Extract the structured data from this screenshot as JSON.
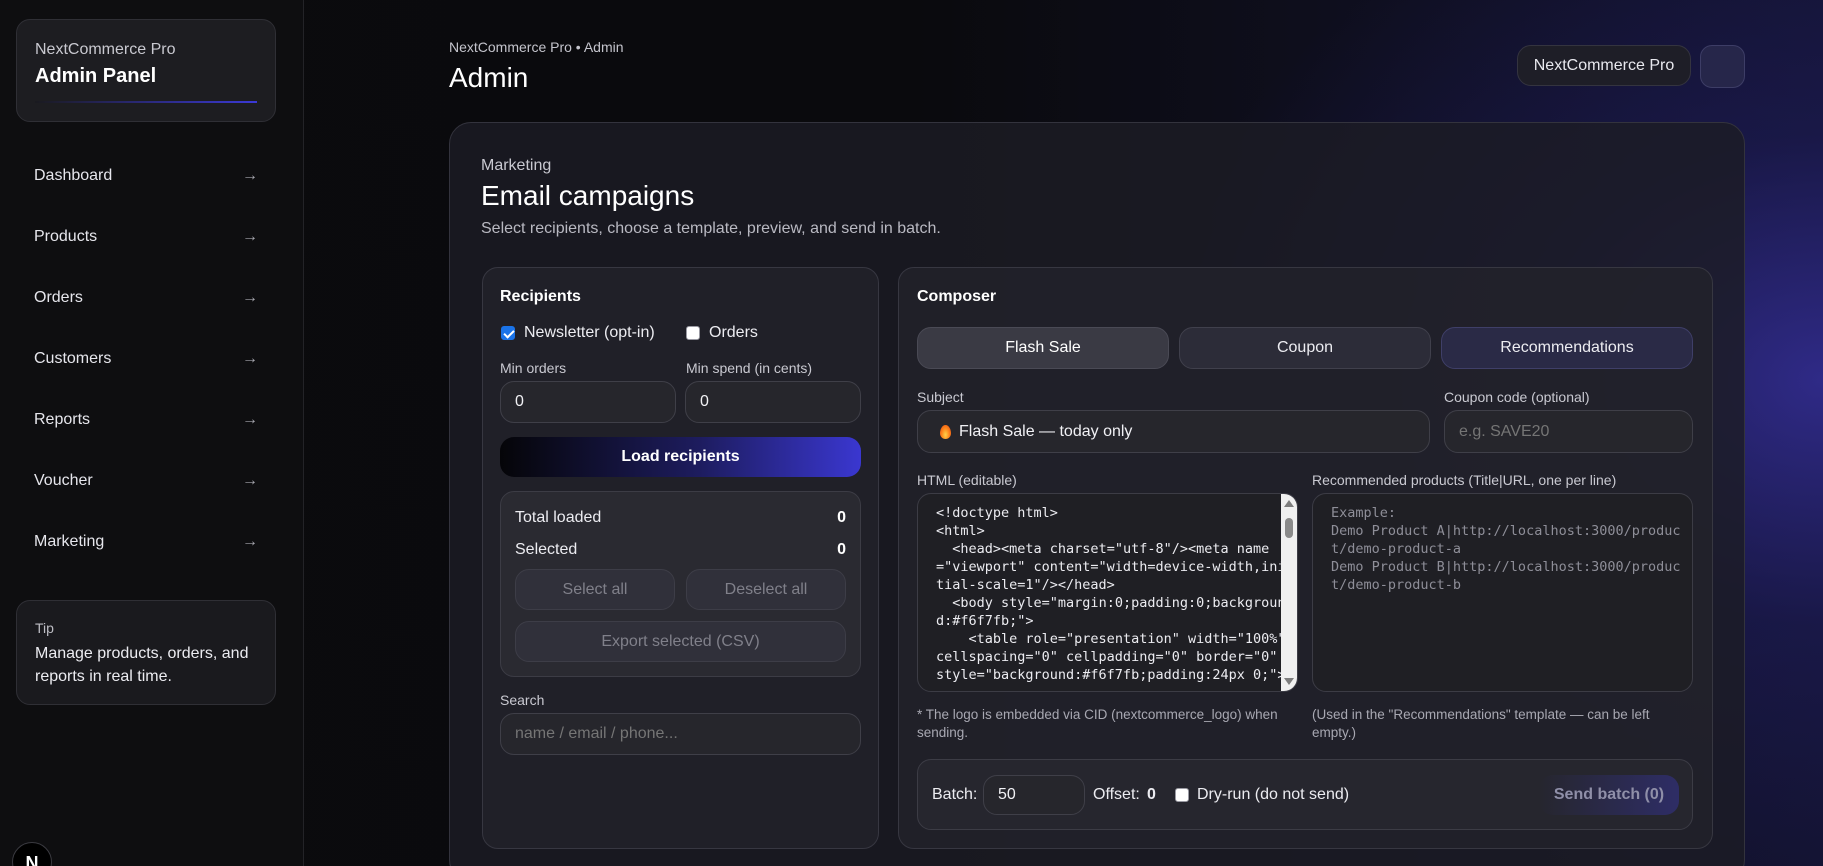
{
  "app": {
    "brand_sub": "NextCommerce Pro",
    "brand_title": "Admin Panel",
    "breadcrumb": "NextCommerce Pro • Admin",
    "page_title": "Admin",
    "top_pill": "NextCommerce Pro",
    "logo_letter": "N"
  },
  "sidebar": {
    "items": [
      {
        "label": "Dashboard",
        "arrow": "→"
      },
      {
        "label": "Products",
        "arrow": "→"
      },
      {
        "label": "Orders",
        "arrow": "→"
      },
      {
        "label": "Customers",
        "arrow": "→"
      },
      {
        "label": "Reports",
        "arrow": "→"
      },
      {
        "label": "Voucher",
        "arrow": "→"
      },
      {
        "label": "Marketing",
        "arrow": "→"
      }
    ],
    "tip_label": "Tip",
    "tip_text": "Manage products, orders, and reports in real time."
  },
  "section": {
    "label": "Marketing",
    "title": "Email campaigns",
    "description": "Select recipients, choose a template, preview, and send in batch."
  },
  "recipients": {
    "title": "Recipients",
    "newsletter_label": "Newsletter (opt-in)",
    "newsletter_checked": true,
    "orders_label": "Orders",
    "orders_checked": false,
    "min_orders_label": "Min orders",
    "min_orders_value": "0",
    "min_spend_label": "Min spend (in cents)",
    "min_spend_value": "0",
    "load_button": "Load recipients",
    "total_loaded_label": "Total loaded",
    "total_loaded_value": "0",
    "selected_label": "Selected",
    "selected_value": "0",
    "select_all": "Select all",
    "deselect_all": "Deselect all",
    "export_csv": "Export selected (CSV)",
    "search_label": "Search",
    "search_placeholder": "name / email / phone..."
  },
  "composer": {
    "title": "Composer",
    "tabs": [
      {
        "label": "Flash Sale"
      },
      {
        "label": "Coupon"
      },
      {
        "label": "Recommendations"
      }
    ],
    "subject_label": "Subject",
    "subject_value": "Flash Sale — today only",
    "coupon_label": "Coupon code (optional)",
    "coupon_placeholder": "e.g. SAVE20",
    "html_label": "HTML (editable)",
    "html_value": "<!doctype html>\n<html>\n  <head><meta charset=\"utf-8\"/><meta name=\"viewport\" content=\"width=device-width,initial-scale=1\"/></head>\n  <body style=\"margin:0;padding:0;background:#f6f7fb;\">\n    <table role=\"presentation\" width=\"100%\" cellspacing=\"0\" cellpadding=\"0\" border=\"0\" style=\"background:#f6f7fb;padding:24px 0;\">",
    "html_note": "* The logo is embedded via CID (nextcommerce_logo) when sending.",
    "rec_label": "Recommended products (Title|URL, one per line)",
    "rec_placeholder": "Example:\nDemo Product A|http://localhost:3000/product/demo-product-a\nDemo Product B|http://localhost:3000/product/demo-product-b",
    "rec_note": "(Used in the \"Recommendations\" template — can be left empty.)",
    "batch_label": "Batch:",
    "batch_value": "50",
    "offset_label": "Offset:",
    "offset_value": "0",
    "dryrun_label": "Dry-run (do not send)",
    "dryrun_checked": false,
    "send_button": "Send batch (0)"
  },
  "colors": {
    "accent": "#3a37d0",
    "background": "#0a0a0c",
    "checkbox": "#1a73e8"
  }
}
